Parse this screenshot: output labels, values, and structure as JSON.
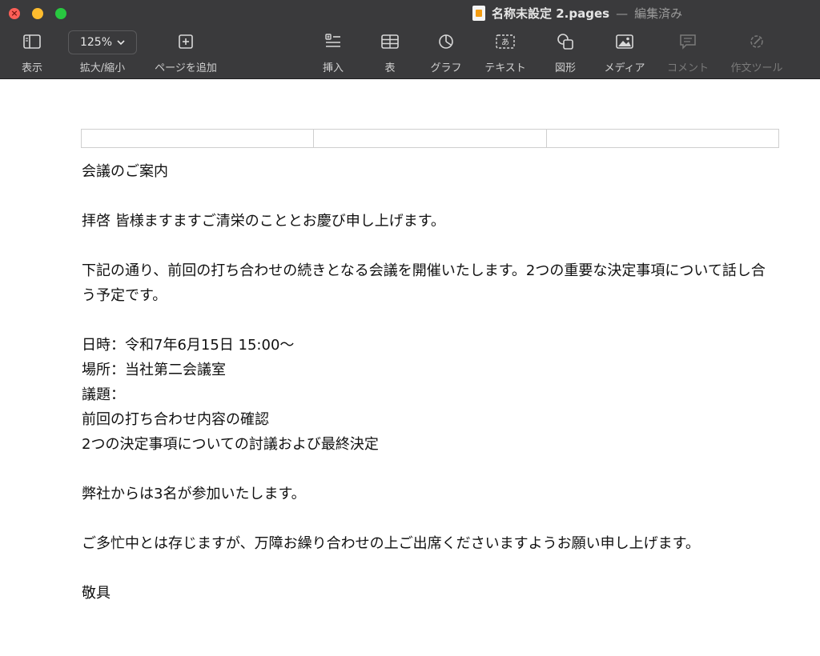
{
  "window": {
    "title": "名称未設定 2.pages",
    "separator": "—",
    "status": "編集済み"
  },
  "toolbar": {
    "view_label": "表示",
    "zoom_value": "125%",
    "zoom_label": "拡大/縮小",
    "add_page_label": "ページを追加",
    "insert_label": "挿入",
    "table_label": "表",
    "chart_label": "グラフ",
    "text_label": "テキスト",
    "shape_label": "図形",
    "media_label": "メディア",
    "comment_label": "コメント",
    "writing_tools_label": "作文ツール"
  },
  "document": {
    "heading": "会議のご案内",
    "greeting": "拝啓 皆様ますますご清栄のこととお慶び申し上げます。",
    "intro": "下記の通り、前回の打ち合わせの続きとなる会議を開催いたします。2つの重要な決定事項について話し合う予定です。",
    "datetime": "日時：令和7年6月15日 15:00〜",
    "place": "場所：当社第二会議室",
    "agenda_label": "議題：",
    "agenda_item_1": "前回の打ち合わせ内容の確認",
    "agenda_item_2": "2つの決定事項についての討議および最終決定",
    "attendance": "弊社からは3名が参加いたします。",
    "request": "ご多忙中とは存じますが、万障お繰り合わせの上ご出席くださいますようお願い申し上げます。",
    "closing": "敬具"
  },
  "icons": {
    "view": "sidebar-icon",
    "add_page": "plus-square-icon",
    "insert": "insert-icon",
    "table": "table-icon",
    "chart": "chart-icon",
    "text": "text-box-icon",
    "shape": "shape-icon",
    "media": "image-icon",
    "comment": "comment-icon",
    "writing_tools": "writing-tools-icon"
  }
}
